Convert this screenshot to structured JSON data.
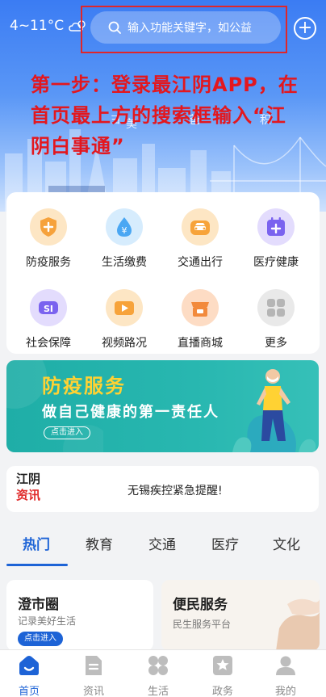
{
  "header": {
    "weather": "4~11°C",
    "search_placeholder": "输入功能关键字，如公益",
    "ghost_labels": [
      "ヨ",
      "美",
      "爸",
      "积"
    ]
  },
  "annotation": "第一步：登录最江阴APP，在首页最上方的搜索框输入“江阴白事通”",
  "services": [
    {
      "label": "防疫服务",
      "icon": "shield-plus-icon",
      "color": "#f6a23c"
    },
    {
      "label": "生活缴费",
      "icon": "yen-drop-icon",
      "color": "#4aa7f3"
    },
    {
      "label": "交通出行",
      "icon": "car-icon",
      "color": "#f7a33a"
    },
    {
      "label": "医疗健康",
      "icon": "medical-calendar-icon",
      "color": "#7a63ef"
    },
    {
      "label": "社会保障",
      "icon": "social-security-icon",
      "color": "#7a63ef"
    },
    {
      "label": "视频路况",
      "icon": "video-camera-icon",
      "color": "#f7a33a"
    },
    {
      "label": "直播商城",
      "icon": "shop-icon",
      "color": "#f28a3c"
    },
    {
      "label": "更多",
      "icon": "more-grid-icon",
      "color": "#b5b5b5"
    }
  ],
  "banner": {
    "title": "防疫服务",
    "subtitle": "做自己健康的第一责任人",
    "button": "点击进入"
  },
  "news": {
    "logo_top": "江阴",
    "logo_bottom": "资讯",
    "headline": "无锡疾控紧急提醒!"
  },
  "tabs": [
    "热门",
    "教育",
    "交通",
    "医疗",
    "文化"
  ],
  "cards": [
    {
      "title": "澄市圈",
      "subtitle": "记录美好生活",
      "button": "点击进入"
    },
    {
      "title": "便民服务",
      "subtitle": "民生服务平台"
    }
  ],
  "bottom_nav": [
    {
      "label": "首页",
      "icon": "home-icon",
      "active": true
    },
    {
      "label": "资讯",
      "icon": "news-icon"
    },
    {
      "label": "生活",
      "icon": "life-icon"
    },
    {
      "label": "政务",
      "icon": "government-icon"
    },
    {
      "label": "我的",
      "icon": "profile-icon"
    }
  ],
  "colors": {
    "primary": "#1d63d6",
    "annotation": "#e3171e",
    "banner": "#22b1aa",
    "banner_title": "#ffd233"
  }
}
